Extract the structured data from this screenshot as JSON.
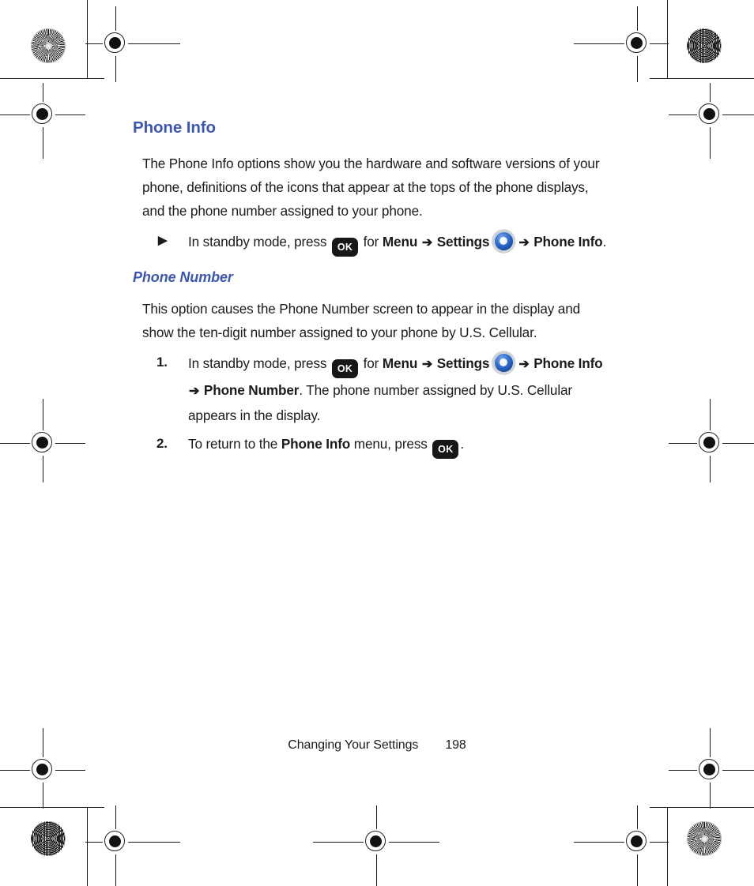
{
  "document": {
    "section_title": "Phone Info",
    "intro_paragraph": "The Phone Info options show you the hardware and software versions of your phone, definitions of the icons that appear at the tops of the phone displays, and the phone number assigned to your phone.",
    "bullet_step": {
      "marker": "▶",
      "text_before_key": "In standby mode, press",
      "key_label": "OK",
      "text_for": "for",
      "menu_1": "Menu",
      "arrow": "➔",
      "menu_2": "Settings",
      "gear_icon": "settings-gear-icon",
      "menu_3": "Phone Info",
      "period": "."
    },
    "sub_title": "Phone Number",
    "sub_paragraph": "This option causes the Phone Number screen to appear in the display and show the ten-digit number assigned to your phone by U.S. Cellular.",
    "numbered_steps": [
      {
        "marker": "1.",
        "text_before_key": "In standby mode, press",
        "key_label": "OK",
        "text_for": "for",
        "menu_1": "Menu",
        "arrow": "➔",
        "menu_2": "Settings",
        "gear_icon": "settings-gear-icon",
        "menu_3": "Phone Info",
        "menu_4": "Phone Number",
        "text_after": ". The phone number assigned by U.S. Cellular appears in the display."
      },
      {
        "marker": "2.",
        "text_before": "To return to the",
        "bold_target": "Phone Info",
        "text_middle": "menu, press",
        "key_label": "OK",
        "text_after": "."
      }
    ]
  },
  "footer": {
    "label": "Changing Your Settings",
    "page_number": "198"
  },
  "colors": {
    "heading_blue": "#3c56b4",
    "body_text": "#1b1b1b",
    "key_background": "#17171a",
    "gear_blue": "#2f6fd0",
    "gear_gray": "#d6d9dd"
  },
  "print_marks": {
    "registration_target": "registration-target-icon",
    "star_target": "star-target-icon",
    "moire_target": "moire-target-icon"
  }
}
